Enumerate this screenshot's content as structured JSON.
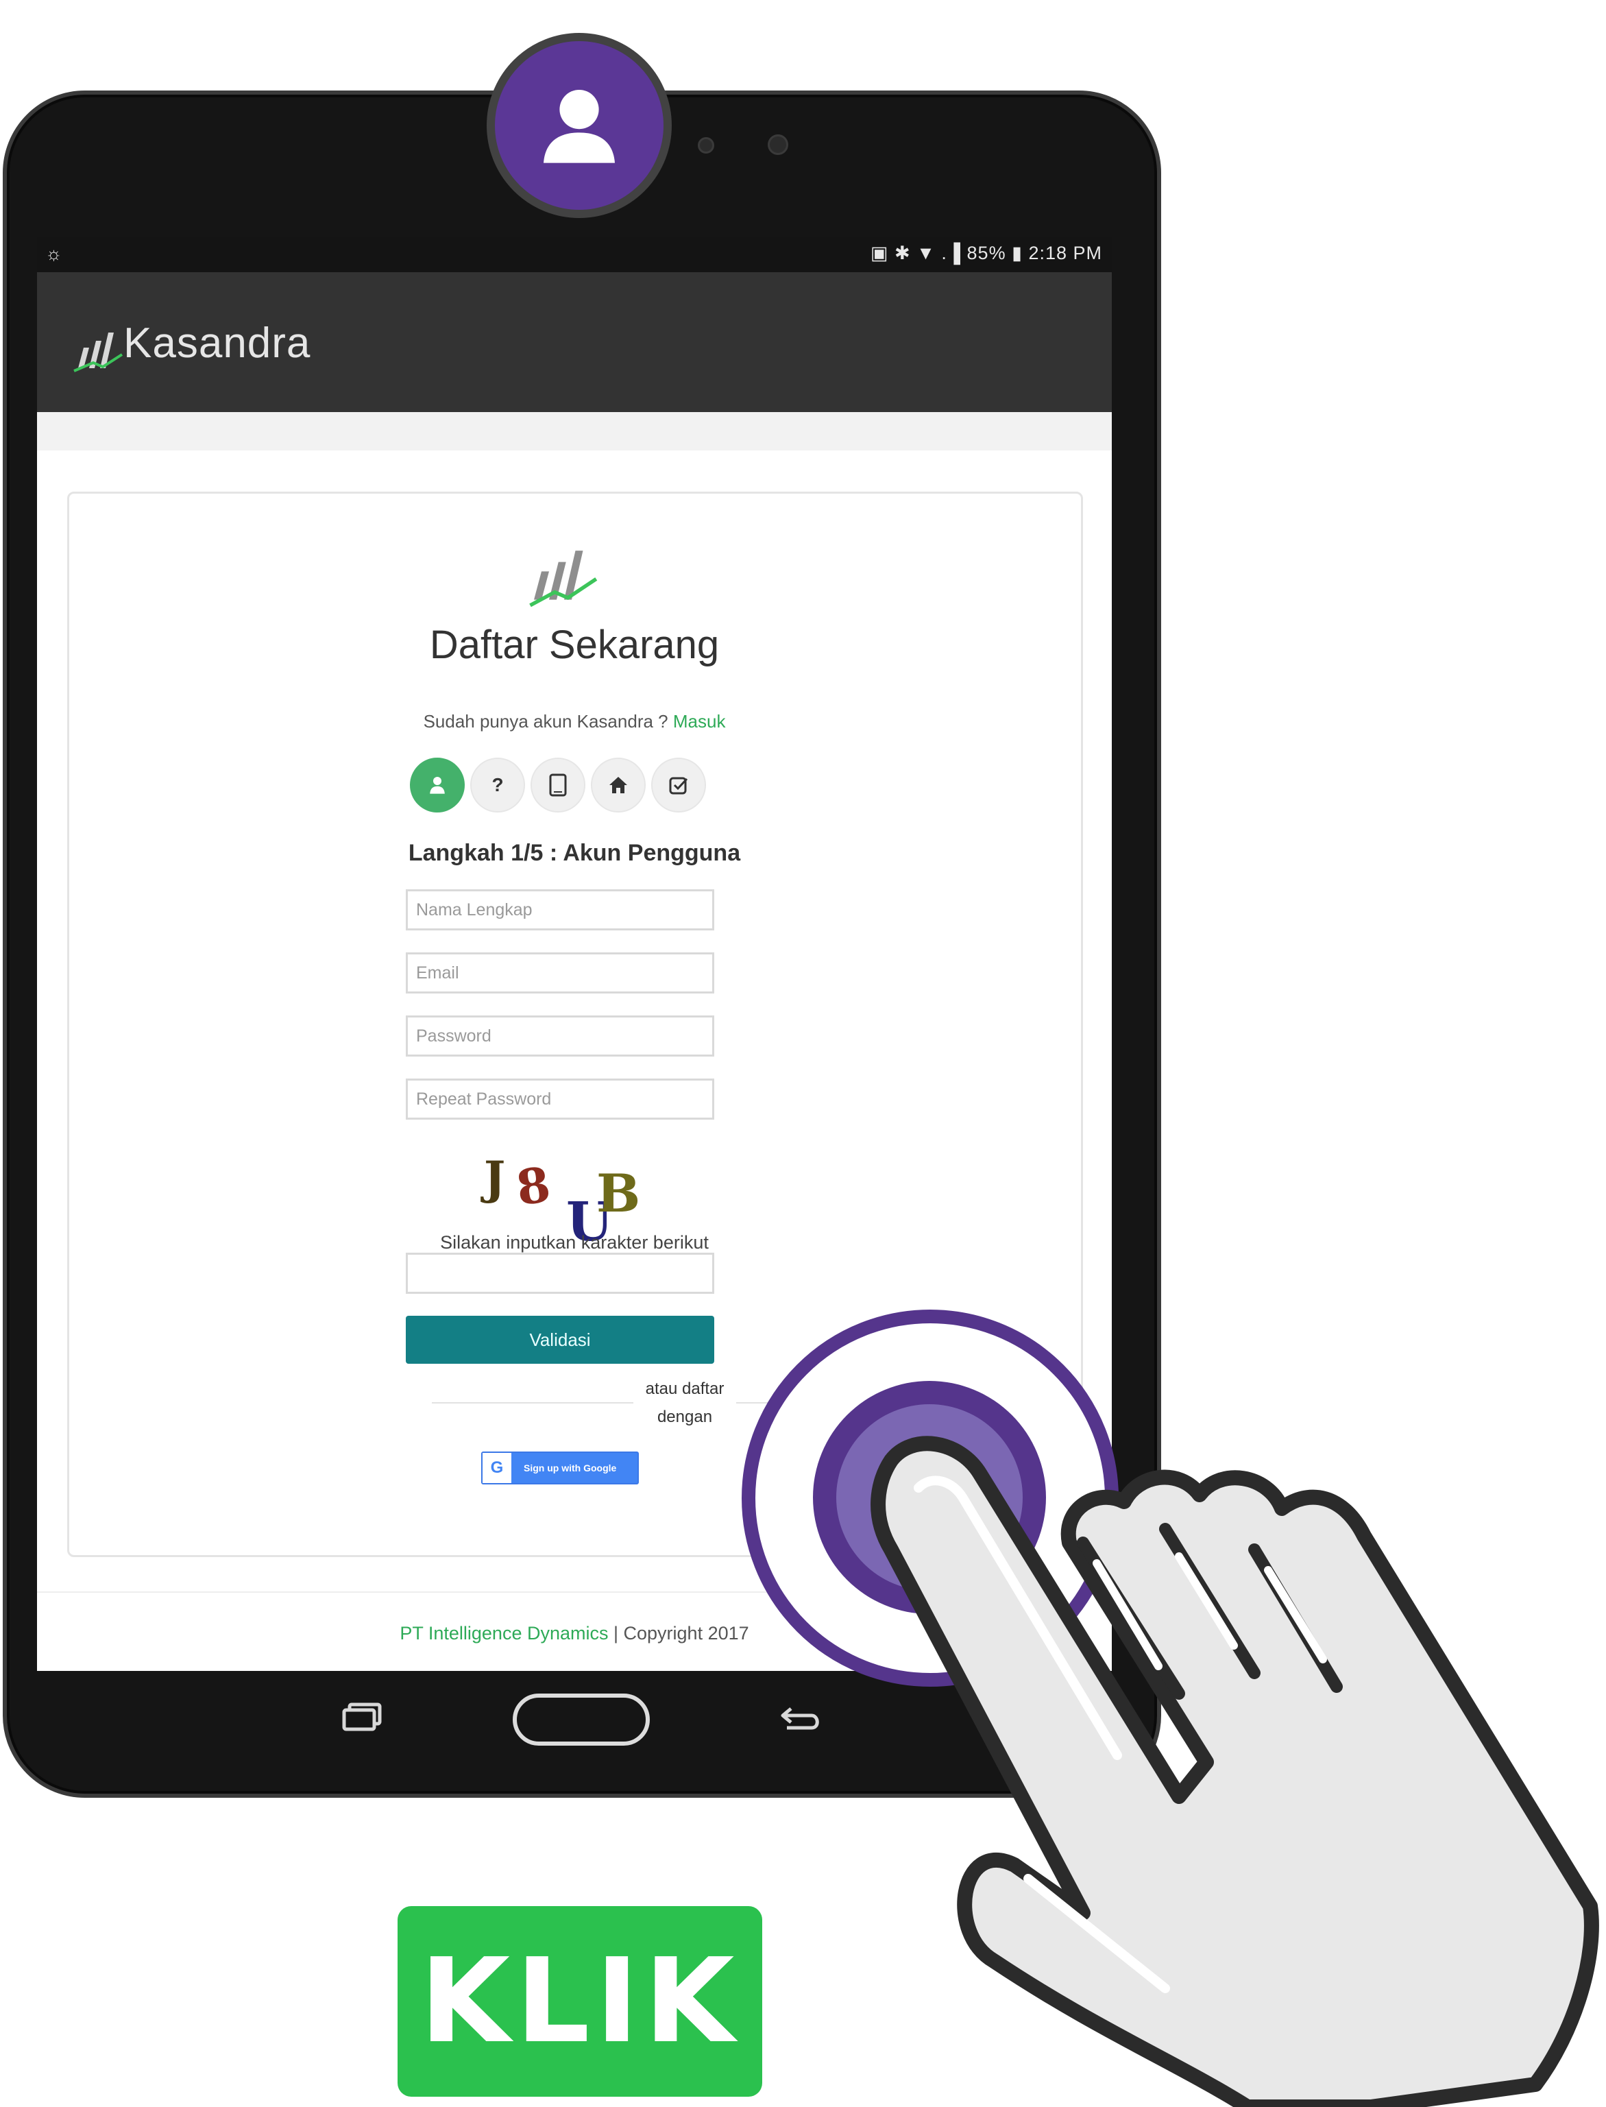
{
  "status_bar": {
    "left_icon": "brightness-icon",
    "right_text": "▣ ✱ ▼ .▐ 85% ▮ 2:18 PM",
    "battery": "85%",
    "time": "2:18 PM"
  },
  "app": {
    "name": "Kasandra",
    "logo_icon": "kasandra-logo-icon"
  },
  "form": {
    "title": "Daftar Sekarang",
    "login_prompt": "Sudah punya akun Kasandra ?",
    "login_link": "Masuk",
    "steps": [
      {
        "icon": "user-icon",
        "active": true
      },
      {
        "icon": "question-icon",
        "label": "?",
        "active": false
      },
      {
        "icon": "tablet-icon",
        "active": false
      },
      {
        "icon": "home-icon",
        "active": false
      },
      {
        "icon": "check-square-icon",
        "active": false
      }
    ],
    "step_title": "Langkah 1/5 : Akun Pengguna",
    "fields": {
      "full_name_placeholder": "Nama Lengkap",
      "email_placeholder": "Email",
      "password_placeholder": "Password",
      "repeat_password_placeholder": "Repeat Password"
    },
    "captcha": {
      "chars": [
        "J",
        "8",
        "U",
        "B"
      ],
      "label": "Silakan inputkan karakter berikut"
    },
    "validate_button": "Validasi",
    "or_text_line1": "atau daftar",
    "or_text_line2": "dengan",
    "google_button": "Sign up with Google",
    "google_g": "G"
  },
  "footer": {
    "company": "PT Intelligence Dynamics",
    "separator": " | ",
    "copyright": "Copyright 2017"
  },
  "overlay": {
    "avatar_icon": "user-icon",
    "touch_indicator": "touch-ripple",
    "hand_icon": "pointing-hand-icon",
    "cta_button": "KLIK"
  },
  "colors": {
    "purple": "#55358c",
    "green_accent": "#2eaa57",
    "teal_button": "#137f85",
    "cta_green": "#2bc14e",
    "appbar": "#333333"
  }
}
